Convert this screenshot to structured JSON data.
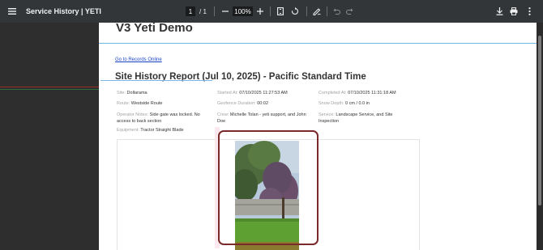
{
  "toolbar": {
    "title": "Service History | YETI",
    "page_current": "1",
    "page_total": "/ 1",
    "zoom": "100%",
    "icons": [
      "menu-icon",
      "zoom-out-icon",
      "zoom-in-icon",
      "fit-page-icon",
      "rotate-icon",
      "draw-icon",
      "undo-icon",
      "redo-icon",
      "download-icon",
      "print-icon",
      "more-icon"
    ]
  },
  "document": {
    "company": "V3 Yeti Demo",
    "records_link": "Go to Records Online",
    "report_title": "Site History Report (Jul 10, 2025) - Pacific Standard Time",
    "fields": {
      "site_label": "Site:",
      "site_value": "Dollarama",
      "route_label": "Route:",
      "route_value": "Westside Route",
      "operator_label": "Operator Notes:",
      "operator_value": "Side gate was locked. No access to back section",
      "equipment_label": "Equipment:",
      "equipment_value": "Tractor Straight Blade",
      "started_label": "Started At:",
      "started_value": "07/10/2025 11:27:53 AM",
      "geofence_label": "Geofence Duration:",
      "geofence_value": "00:02",
      "crew_label": "Crew:",
      "crew_value": "Michelle Tolan - yeti support, and John Doe",
      "completed_label": "Completed At:",
      "completed_value": "07/10/2025 11:31:18 AM",
      "snow_label": "Snow Depth:",
      "snow_value": "0 cm / 0.0 in",
      "service_label": "Service:",
      "service_value": "Landscape Service, and Site Inspection"
    }
  },
  "colors": {
    "toolbar_bg": "#323639",
    "link": "#1a44c7",
    "accent_line": "#6fb6df",
    "photo_border": "#7b2a2a"
  }
}
